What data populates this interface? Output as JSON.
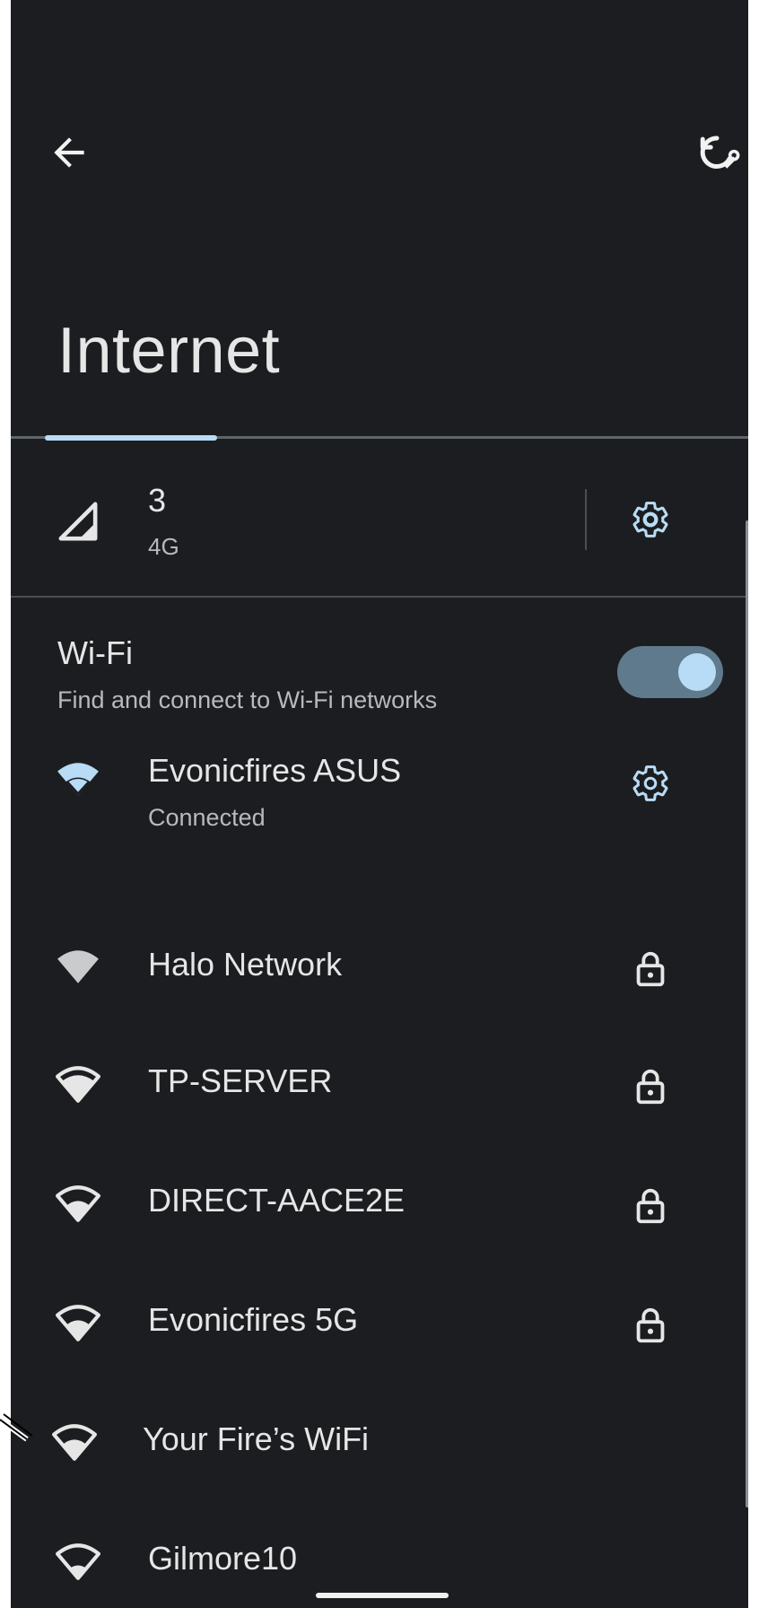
{
  "page": {
    "title": "Internet"
  },
  "mobile": {
    "carrier": "3",
    "type": "4G"
  },
  "wifi": {
    "title": "Wi-Fi",
    "subtitle": "Find and connect to Wi-Fi networks",
    "enabled": true
  },
  "networks": [
    {
      "name": "Evonicfires ASUS",
      "status": "Connected",
      "icon": "wifi-full-icon",
      "trailing": "gear-icon"
    },
    {
      "name": "Halo Network",
      "icon": "wifi-full-icon",
      "trailing": "lock-icon"
    },
    {
      "name": "TP-SERVER",
      "icon": "wifi-3-icon",
      "trailing": "lock-icon"
    },
    {
      "name": "DIRECT-AACE2E",
      "icon": "wifi-2-icon",
      "trailing": "lock-icon"
    },
    {
      "name": "Evonicfires 5G",
      "icon": "wifi-2-icon",
      "trailing": "lock-icon"
    },
    {
      "name": "Your Fire’s WiFi",
      "icon": "wifi-2-icon",
      "trailing": ""
    },
    {
      "name": "Gilmore10",
      "icon": "wifi-1-icon",
      "trailing": ""
    }
  ],
  "colors": {
    "background": "#1c1d20",
    "accent": "#b8dcf5",
    "text": "#e6e6e6",
    "secondary": "#b7babd"
  }
}
